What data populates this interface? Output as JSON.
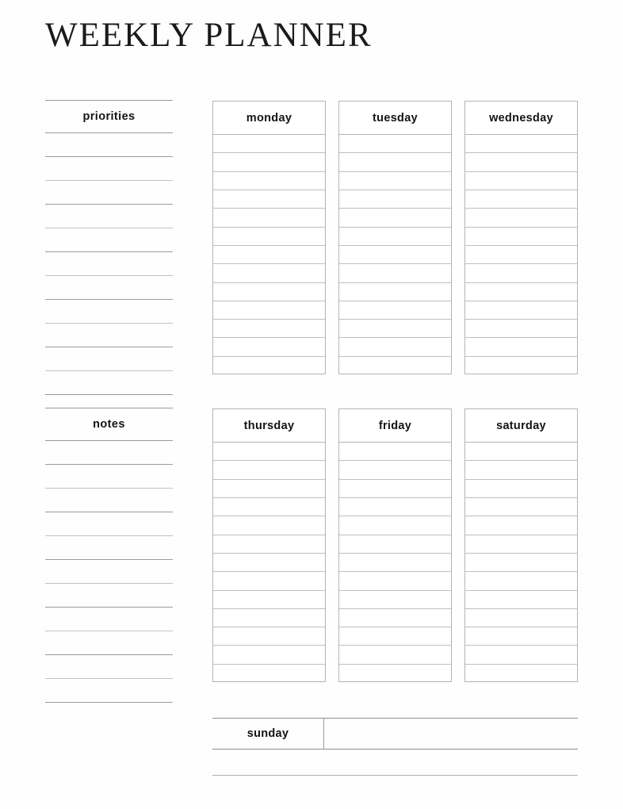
{
  "document": {
    "title": "WEEKLY PLANNER"
  },
  "left_column": {
    "priorities": {
      "label": "priorities",
      "line_count": 11
    },
    "notes": {
      "label": "notes",
      "line_count": 11
    }
  },
  "day_grid": {
    "row_line_count": 13,
    "rows": [
      {
        "days": [
          {
            "label": "monday"
          },
          {
            "label": "tuesday"
          },
          {
            "label": "wednesday"
          }
        ]
      },
      {
        "days": [
          {
            "label": "thursday"
          },
          {
            "label": "friday"
          },
          {
            "label": "saturday"
          }
        ]
      }
    ]
  },
  "sunday": {
    "label": "sunday",
    "value": ""
  },
  "colors": {
    "page_background": "#fefefe",
    "text": "#141416",
    "title_text": "#1b1b1d",
    "box_border": "#b4b4b4",
    "inner_rule": "#c0c0c0",
    "left_rule": "#9a9a9a"
  }
}
